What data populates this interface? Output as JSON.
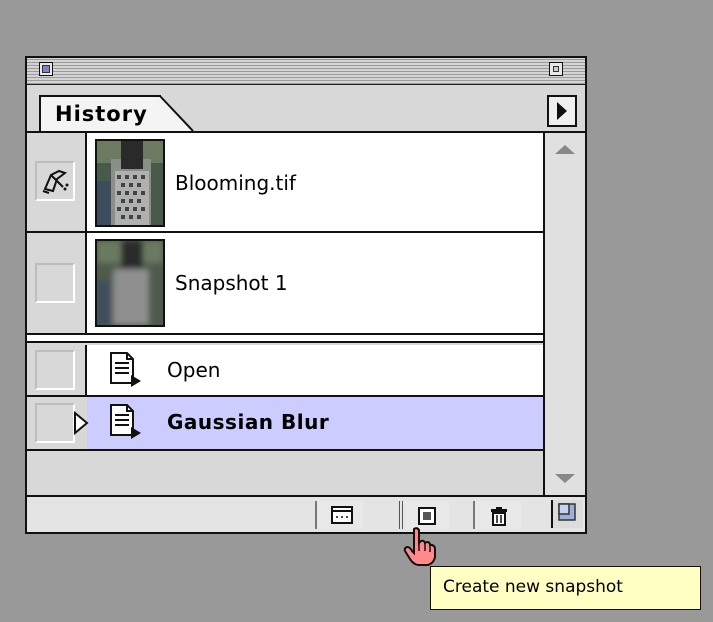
{
  "palette": {
    "tab_label": "History",
    "source_state": {
      "label": "Blooming.tif",
      "brush_icon": "history-brush-icon"
    },
    "snapshots": [
      {
        "label": "Snapshot 1"
      }
    ],
    "history_states": [
      {
        "label": "Open",
        "selected": false,
        "icon": "document-icon"
      },
      {
        "label": "Gaussian Blur",
        "selected": true,
        "icon": "document-icon"
      }
    ],
    "toolbar": {
      "new_document_icon": "new-document-icon",
      "new_snapshot_icon": "new-snapshot-icon",
      "delete_icon": "trash-icon"
    }
  },
  "tooltip": {
    "text": "Create new snapshot"
  },
  "colors": {
    "desktop": "#999999",
    "selected_row": "#ccccff",
    "tooltip_bg": "#ffffc4"
  }
}
